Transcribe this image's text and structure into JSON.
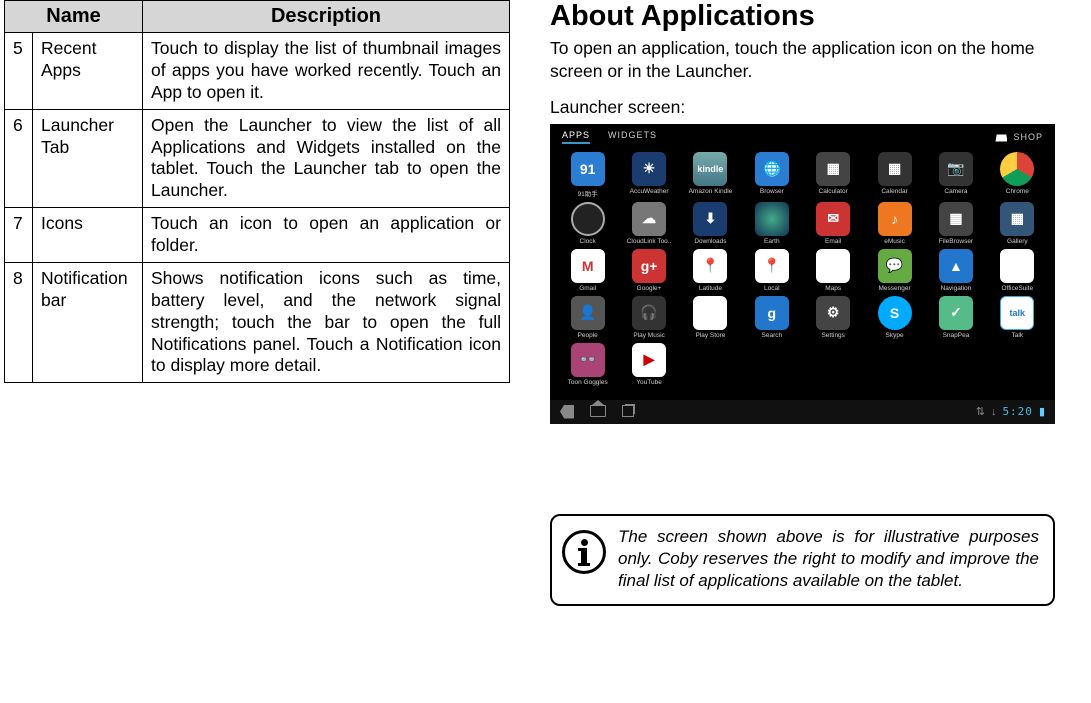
{
  "table": {
    "headers": {
      "name": "Name",
      "description": "Description"
    },
    "rows": [
      {
        "num": "5",
        "name": "Recent Apps",
        "desc": "Touch to display the list of thumbnail images of apps you have worked recently. Touch an App to open it."
      },
      {
        "num": "6",
        "name": "Launcher Tab",
        "desc": "Open the Launcher to view the list of all Applications and Widgets installed on the tablet. Touch the Launcher tab to open the Launcher."
      },
      {
        "num": "7",
        "name": "Icons",
        "desc": "Touch an icon to open an application or folder."
      },
      {
        "num": "8",
        "name": "Notification bar",
        "desc": "Shows notification icons such as time, battery level, and the network signal strength; touch the bar to open the full Notifications panel. Touch a Notification icon to display more detail."
      }
    ]
  },
  "heading": "About Applications",
  "intro": "To open an application, touch the application icon on the home screen or in the Launcher.",
  "subhead": "Launcher screen:",
  "launcher": {
    "tab_apps": "APPS",
    "tab_widgets": "WIDGETS",
    "shop": "SHOP",
    "clock": "5:20",
    "apps": [
      "91助手",
      "AccuWeather",
      "Amazon Kindle",
      "Browser",
      "Calculator",
      "Calendar",
      "Camera",
      "Chrome",
      "Clock",
      "CloudLink Too..",
      "Downloads",
      "Earth",
      "Email",
      "eMusic",
      "FileBrowser",
      "Gallery",
      "Gmail",
      "Google+",
      "Latitude",
      "Local",
      "Maps",
      "Messenger",
      "Navigation",
      "OfficeSuite",
      "People",
      "Play Music",
      "Play Store",
      "Search",
      "Settings",
      "Skype",
      "SnapPea",
      "Talk",
      "Toon Goggles",
      "YouTube"
    ]
  },
  "note": "The screen shown above is for illustrative purposes only. Coby reserves the right to modify  and improve the final list of applications available on the tablet."
}
